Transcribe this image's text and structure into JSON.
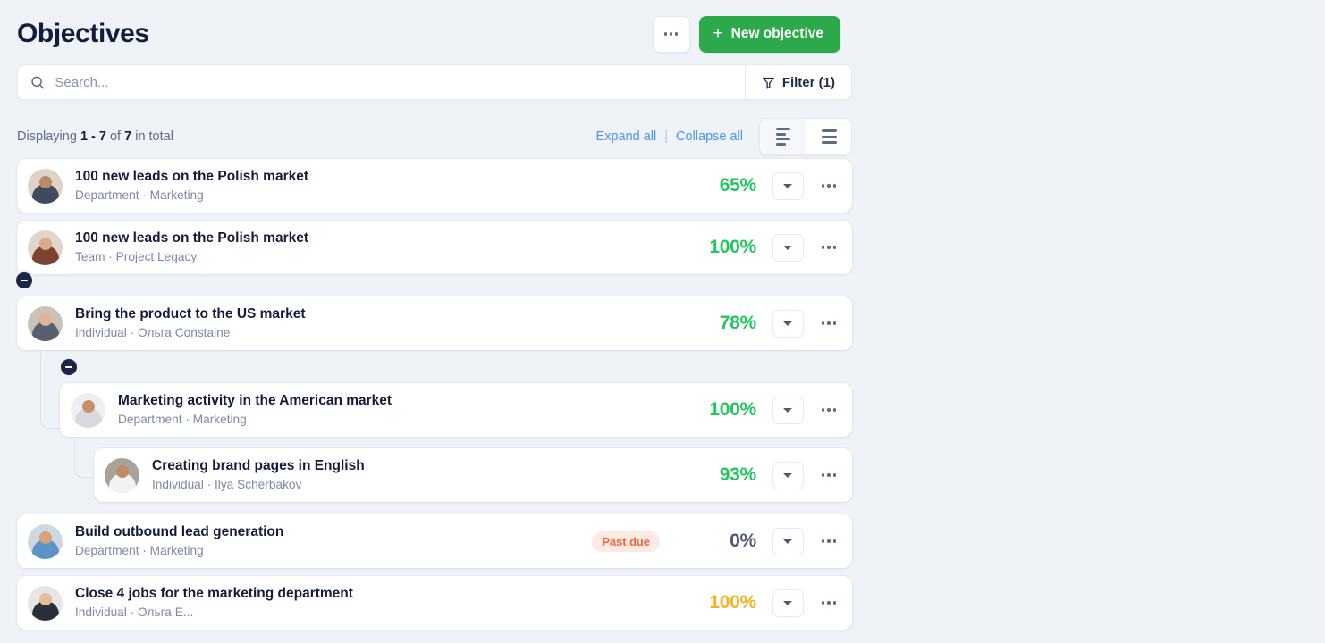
{
  "header": {
    "title": "Objectives",
    "more_label": "more-options",
    "new_objective_label": "New objective",
    "plus": "+"
  },
  "search": {
    "placeholder": "Search...",
    "value": "",
    "filter_label": "Filter (1)",
    "search_icon": "search-icon",
    "filter_icon": "funnel-icon"
  },
  "meta": {
    "displaying_prefix": "Displaying",
    "range": "1 - 7",
    "of": "of",
    "total": "7",
    "suffix": "in total",
    "expand_all": "Expand all",
    "separator": "|",
    "collapse_all": "Collapse all",
    "view_tree_icon": "align-left-list-icon",
    "view_list_icon": "list-icon"
  },
  "objectives": [
    {
      "title": "100 new leads on the Polish market",
      "subtitle": "Department · Marketing",
      "percent": "65%",
      "percent_color": "green",
      "badge": "",
      "level": 1,
      "avatar": {
        "skin": "#b98a6a",
        "hair": "#4a3526",
        "shirt": "#3f4a5c",
        "bg": "#ded3c6"
      }
    },
    {
      "title": "100 new leads on the Polish market",
      "subtitle": "Team · Project Legacy",
      "percent": "100%",
      "percent_color": "green",
      "badge": "",
      "level": 1,
      "avatar": {
        "skin": "#dca98b",
        "hair": "#6d3a22",
        "shirt": "#7c4430",
        "bg": "#e0d7cc"
      }
    },
    {
      "title": "Bring the product to the US market",
      "subtitle": "Individual · Ольга Constaine",
      "percent": "78%",
      "percent_color": "green",
      "badge": "",
      "level": 1,
      "avatar": {
        "skin": "#e2b394",
        "hair": "#7d3d22",
        "shirt": "#55606f",
        "bg": "#c9c2b6"
      }
    },
    {
      "title": "Marketing activity in the American market",
      "subtitle": "Department · Marketing",
      "percent": "100%",
      "percent_color": "green",
      "badge": "",
      "level": 2,
      "avatar": {
        "skin": "#c79166",
        "hair": "#25211f",
        "shirt": "#d6d9dd",
        "bg": "#eceef1"
      }
    },
    {
      "title": "Creating brand pages in English",
      "subtitle": "Individual · Ilya Scherbakov",
      "percent": "93%",
      "percent_color": "green",
      "badge": "",
      "level": 3,
      "avatar": {
        "skin": "#c08c63",
        "hair": "#554a44",
        "shirt": "#f2f2f2",
        "bg": "#a9a29a"
      }
    },
    {
      "title": "Build outbound lead generation",
      "subtitle": "Department · Marketing",
      "percent": "0%",
      "percent_color": "grey",
      "badge": "Past due",
      "level": 1,
      "avatar": {
        "skin": "#d9a277",
        "hair": "#4c3526",
        "shirt": "#5b93c9",
        "bg": "#cdd9e2"
      }
    },
    {
      "title": "Close 4 jobs for the marketing department",
      "subtitle": "Individual · Ольга Е...",
      "percent": "100%",
      "percent_color": "amber",
      "badge": "",
      "level": 1,
      "avatar": {
        "skin": "#e3bd9c",
        "hair": "#c8a45e",
        "shirt": "#2b2f3a",
        "bg": "#e7e6e4"
      }
    }
  ],
  "colors": {
    "accent_green": "#2ca94a",
    "progress_green": "#22c55e",
    "progress_amber": "#f5b222",
    "link_blue": "#4b93f5",
    "badge_text": "#f4643b",
    "badge_bg": "#fdeae4",
    "page_bg": "#eff2f7",
    "title_ink": "#131c3d"
  }
}
